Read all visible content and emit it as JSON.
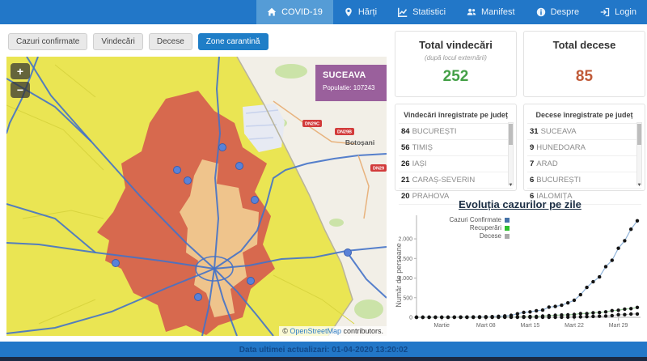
{
  "navbar": {
    "items": [
      {
        "label": "COVID-19",
        "icon": "home-icon",
        "active": true
      },
      {
        "label": "Hărți",
        "icon": "map-marker-icon",
        "active": false
      },
      {
        "label": "Statistici",
        "icon": "line-chart-icon",
        "active": false
      },
      {
        "label": "Manifest",
        "icon": "users-icon",
        "active": false
      },
      {
        "label": "Despre",
        "icon": "info-icon",
        "active": false
      },
      {
        "label": "Login",
        "icon": "sign-in-icon",
        "active": false
      }
    ]
  },
  "filters": {
    "buttons": [
      {
        "label": "Cazuri confirmate",
        "active": false
      },
      {
        "label": "Vindecări",
        "active": false
      },
      {
        "label": "Decese",
        "active": false
      },
      {
        "label": "Zone carantină",
        "active": true
      }
    ]
  },
  "map": {
    "zoom_in": "+",
    "zoom_out": "−",
    "region_label": "SUCEAVA",
    "population_label": "Populatie: 107243",
    "city_label": "Botoșani",
    "shields": [
      {
        "label": "DN29C"
      },
      {
        "label": "DN29B"
      },
      {
        "label": "DN29"
      }
    ],
    "attribution_prefix": "© ",
    "attribution_link": "OpenStreetMap",
    "attribution_suffix": " contributors."
  },
  "stats": {
    "recovered": {
      "title": "Total vindecări",
      "subtitle": "(după locul externării)",
      "value": "252",
      "color": "#44A047"
    },
    "deaths": {
      "title": "Total decese",
      "value": "85",
      "color": "#C05A38"
    }
  },
  "lists": {
    "recovered": {
      "title": "Vindecări înregistrate pe județ",
      "rows": [
        {
          "count": "84",
          "name": "BUCUREȘTI"
        },
        {
          "count": "56",
          "name": "TIMIȘ"
        },
        {
          "count": "26",
          "name": "IAȘI"
        },
        {
          "count": "21",
          "name": "CARAȘ-SEVERIN"
        },
        {
          "count": "20",
          "name": "PRAHOVA"
        }
      ]
    },
    "deaths": {
      "title": "Decese înregistrate pe județ",
      "rows": [
        {
          "count": "31",
          "name": "SUCEAVA"
        },
        {
          "count": "9",
          "name": "HUNEDOARA"
        },
        {
          "count": "7",
          "name": "ARAD"
        },
        {
          "count": "6",
          "name": "BUCUREȘTI"
        },
        {
          "count": "6",
          "name": "IALOMIȚA"
        }
      ]
    }
  },
  "chart_data": {
    "type": "line",
    "title": "Evoluția cazurilor pe zile",
    "ylabel": "Număr de persoane",
    "xlabel": "",
    "ylim": [
      0,
      2600
    ],
    "grid": false,
    "legend_position": "top-left",
    "x": [
      "26 Feb",
      "27 Feb",
      "28 Feb",
      "29 Feb",
      "1 Mar",
      "2 Mar",
      "3 Mar",
      "4 Mar",
      "5 Mar",
      "6 Mar",
      "7 Mar",
      "8 Mar",
      "9 Mar",
      "10 Mar",
      "11 Mar",
      "12 Mar",
      "13 Mar",
      "14 Mar",
      "15 Mar",
      "16 Mar",
      "17 Mar",
      "18 Mar",
      "19 Mar",
      "20 Mar",
      "21 Mar",
      "22 Mar",
      "23 Mar",
      "24 Mar",
      "25 Mar",
      "26 Mar",
      "27 Mar",
      "28 Mar",
      "29 Mar",
      "30 Mar",
      "31 Mar",
      "1 Apr"
    ],
    "xticks": [
      {
        "label": "Martie",
        "index": 4
      },
      {
        "label": "Mart 08",
        "index": 11
      },
      {
        "label": "Mart 15",
        "index": 18
      },
      {
        "label": "Mart 22",
        "index": 25
      },
      {
        "label": "Mart 29",
        "index": 32
      }
    ],
    "yticks": [
      {
        "label": "0",
        "value": 0
      },
      {
        "label": "500",
        "value": 500
      },
      {
        "label": "1.000",
        "value": 1000
      },
      {
        "label": "1.500",
        "value": 1500
      },
      {
        "label": "2.000",
        "value": 2000
      }
    ],
    "series": [
      {
        "name": "Cazuri Confirmate",
        "color": "#4572A7",
        "line_color": "#8FB3D9",
        "values": [
          1,
          1,
          3,
          3,
          3,
          3,
          4,
          6,
          6,
          9,
          13,
          15,
          17,
          25,
          35,
          49,
          89,
          123,
          139,
          168,
          184,
          260,
          277,
          308,
          367,
          433,
          576,
          762,
          906,
          1029,
          1292,
          1452,
          1760,
          1952,
          2245,
          2460
        ]
      },
      {
        "name": "Recuperări",
        "color": "#2FBF2F",
        "line_color": "#9CCF9C",
        "values": [
          0,
          0,
          0,
          0,
          0,
          0,
          0,
          0,
          0,
          0,
          1,
          1,
          3,
          4,
          6,
          9,
          11,
          16,
          19,
          21,
          31,
          41,
          52,
          57,
          62,
          73,
          94,
          95,
          115,
          121,
          139,
          169,
          180,
          209,
          220,
          252
        ]
      },
      {
        "name": "Decese",
        "color": "#AAAAAA",
        "line_color": "#C4C4C4",
        "values": [
          0,
          0,
          0,
          0,
          0,
          0,
          0,
          0,
          0,
          0,
          0,
          0,
          0,
          0,
          0,
          0,
          0,
          0,
          0,
          0,
          0,
          0,
          0,
          3,
          5,
          8,
          11,
          17,
          23,
          26,
          34,
          43,
          65,
          69,
          82,
          85
        ]
      }
    ],
    "marker_color": "#141414"
  },
  "footer": {
    "updated": "Data ultimei actualizari: 01-04-2020 13:20:02"
  }
}
